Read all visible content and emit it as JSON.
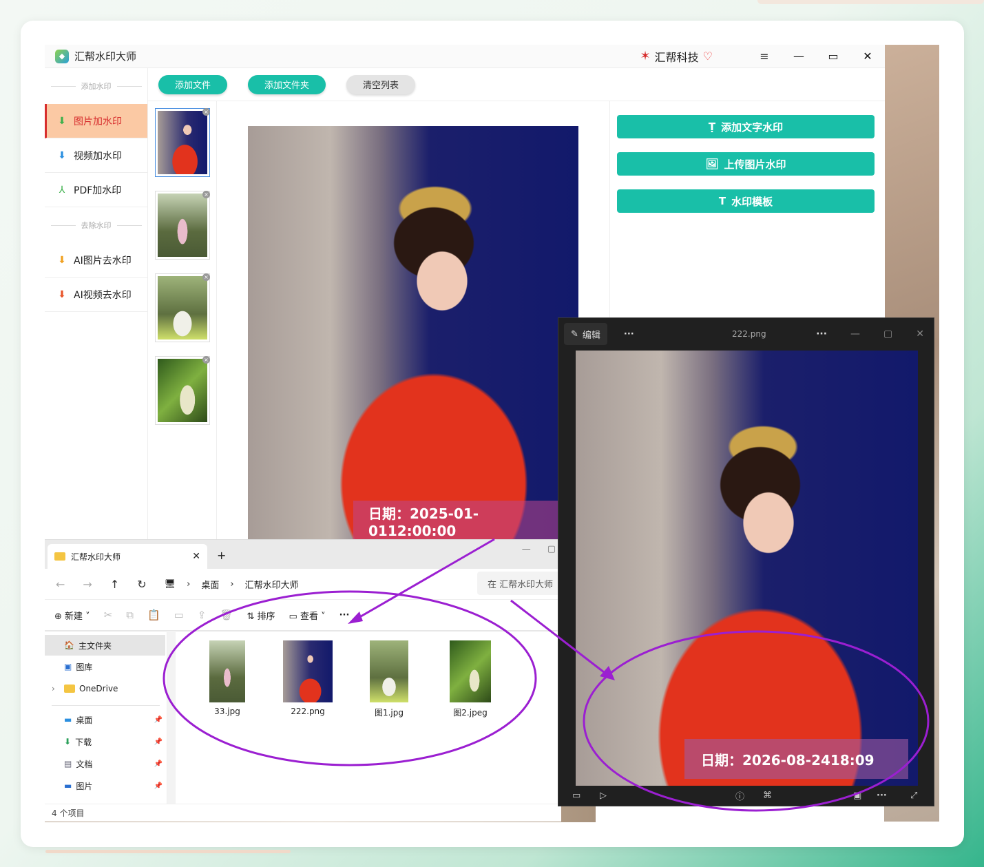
{
  "app": {
    "title": "汇帮水印大师",
    "brand": "汇帮科技",
    "window_controls": [
      "≡",
      "—",
      "▭",
      "✕"
    ]
  },
  "sidebar": {
    "section_add": "添加水印",
    "section_remove": "去除水印",
    "items": [
      {
        "label": "图片加水印",
        "icon": "stamp-icon",
        "active": true
      },
      {
        "label": "视频加水印",
        "icon": "stamp-icon"
      },
      {
        "label": "PDF加水印",
        "icon": "pdf-icon"
      },
      {
        "label": "AI图片去水印",
        "icon": "stamp-icon"
      },
      {
        "label": "AI视频去水印",
        "icon": "stamp-icon"
      }
    ]
  },
  "toolbar": {
    "add_file": "添加文件",
    "add_folder": "添加文件夹",
    "clear_list": "清空列表"
  },
  "actions": {
    "add_text_wm": "添加文字水印",
    "upload_image_wm": "上传图片水印",
    "wm_template": "水印模板"
  },
  "preview": {
    "watermark_text": "日期：2025-01-0112:00:00"
  },
  "explorer": {
    "tab_title": "汇帮水印大师",
    "breadcrumb": [
      "桌面",
      "汇帮水印大师"
    ],
    "search_placeholder": "在 汇帮水印大师",
    "commands": {
      "new": "新建",
      "sort": "排序",
      "view": "查看"
    },
    "sidebar": {
      "home": "主文件夹",
      "gallery": "图库",
      "onedrive": "OneDrive",
      "quick": [
        "桌面",
        "下载",
        "文档",
        "图片"
      ]
    },
    "files": [
      "33.jpg",
      "222.png",
      "图1.jpg",
      "图2.jpeg"
    ],
    "status": "4 个项目"
  },
  "viewer": {
    "edit_label": "编辑",
    "file_name": "222.png",
    "watermark_text": "日期：2026-08-2418:09"
  },
  "colors": {
    "accent": "#19bfa8",
    "active_nav_bg": "#fbc9a4",
    "active_nav_text": "#d72d2d",
    "annotation": "#9b1fd1"
  }
}
